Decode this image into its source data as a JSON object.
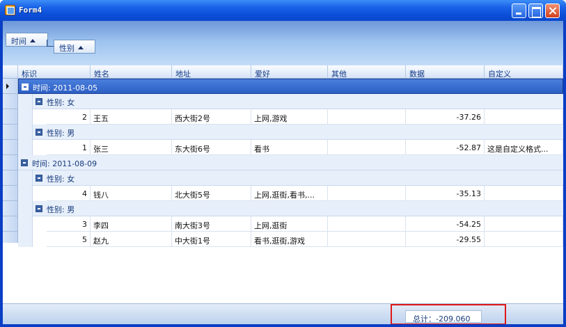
{
  "window": {
    "title": "Form4"
  },
  "group_panel": {
    "buttons": [
      {
        "label": "时间"
      },
      {
        "label": "性别"
      }
    ]
  },
  "columns": [
    "标识",
    "姓名",
    "地址",
    "爱好",
    "其他",
    "数据",
    "自定义"
  ],
  "groups": [
    {
      "label": "时间: 2011-08-05",
      "selected": true,
      "subgroups": [
        {
          "label": "性别: 女",
          "rows": [
            {
              "id": "2",
              "name": "王五",
              "address": "西大街2号",
              "hobby": "上网,游戏",
              "other": "",
              "data": "-37.26",
              "custom": ""
            }
          ]
        },
        {
          "label": "性别: 男",
          "rows": [
            {
              "id": "1",
              "name": "张三",
              "address": "东大街6号",
              "hobby": "看书",
              "other": "",
              "data": "-52.87",
              "custom": "这是自定义格式..."
            }
          ]
        }
      ]
    },
    {
      "label": "时间: 2011-08-09",
      "selected": false,
      "subgroups": [
        {
          "label": "性别: 女",
          "rows": [
            {
              "id": "4",
              "name": "钱八",
              "address": "北大街5号",
              "hobby": "上网,逛街,看书,...",
              "other": "",
              "data": "-35.13",
              "custom": ""
            }
          ]
        },
        {
          "label": "性别: 男",
          "rows": [
            {
              "id": "3",
              "name": "李四",
              "address": "南大街3号",
              "hobby": "上网,逛街",
              "other": "",
              "data": "-54.25",
              "custom": ""
            },
            {
              "id": "5",
              "name": "赵九",
              "address": "中大街1号",
              "hobby": "看书,逛街,游戏",
              "other": "",
              "data": "-29.55",
              "custom": ""
            }
          ]
        }
      ]
    }
  ],
  "footer": {
    "total": "总计：-209.060"
  },
  "colors": {
    "titlebar": "#0b4fd8",
    "selected_group": "#2c5fc4",
    "highlight_box": "#e01818"
  },
  "icons": [
    "app-icon",
    "minimize-icon",
    "maximize-icon",
    "close-icon",
    "sort-ascending-icon",
    "collapse-icon",
    "row-indicator-icon"
  ]
}
